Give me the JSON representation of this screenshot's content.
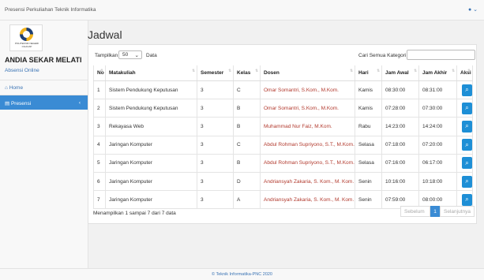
{
  "topbar": {
    "title": "Presensi Perkuliahan Teknik Informatika",
    "user_icon": "user-icon",
    "chevron": "⌄"
  },
  "sidebar": {
    "logo_caption": "POLITEKNIK NEGERI CILACAP",
    "user_name": "ANDIA SEKAR MELATI",
    "user_sub": "Absensi Online",
    "items": [
      {
        "label": "⌂ Home"
      },
      {
        "label": "▤ Presensi",
        "chevron": "‹"
      }
    ]
  },
  "page": {
    "title": "Jadwal"
  },
  "controls": {
    "show_label": "Tampilkan",
    "show_value": "50",
    "show_chevron": "⌄",
    "data_label": "Data",
    "search_label": "Cari Semua Kategori"
  },
  "table": {
    "headers": [
      "No",
      "Matakuliah",
      "Semester",
      "Kelas",
      "Dosen",
      "Hari",
      "Jam Awal",
      "Jam Akhir",
      "Aksi"
    ],
    "sort_glyph": "⇅",
    "action_glyph": "⌕",
    "rows": [
      [
        "1",
        "Sistem Pendukung Keputusan",
        "3",
        "C",
        "Omar Somantri, S.Kom., M.Kom.",
        "Kamis",
        "08:30:00",
        "08:31:00"
      ],
      [
        "2",
        "Sistem Pendukung Keputusan",
        "3",
        "B",
        "Omar Somantri, S.Kom., M.Kom.",
        "Kamis",
        "07:28:00",
        "07:30:00"
      ],
      [
        "3",
        "Rekayasa Web",
        "3",
        "B",
        "Muhammad Nur Faiz, M.Kom.",
        "Rabu",
        "14:23:00",
        "14:24:00"
      ],
      [
        "4",
        "Jaringan Komputer",
        "3",
        "C",
        "Abdul Rohman Supriyono, S.T., M.Kom.",
        "Selasa",
        "07:18:00",
        "07:20:00"
      ],
      [
        "5",
        "Jaringan Komputer",
        "3",
        "B",
        "Abdul Rohman Supriyono, S.T., M.Kom.",
        "Selasa",
        "07:16:00",
        "06:17:00"
      ],
      [
        "6",
        "Jaringan Komputer",
        "3",
        "D",
        "Andriansyah Zakaria, S. Kom., M. Kom.",
        "Senin",
        "10:16:00",
        "10:18:00"
      ],
      [
        "7",
        "Jaringan Komputer",
        "3",
        "A",
        "Andriansyah Zakaria, S. Kom., M. Kom.",
        "Senin",
        "07:59:00",
        "08:00:00"
      ]
    ]
  },
  "footer_info": "Menampilkan 1 sampai 7 dari 7 data",
  "pagination": {
    "prev": "Sebelum",
    "page": "1",
    "next": "Selanjutnya"
  },
  "footer": "© Teknik Informatika-PNC 2020",
  "colors": {
    "accent": "#3a8bd4",
    "action": "#1e8fd6",
    "dosen": "#b23a2e"
  }
}
